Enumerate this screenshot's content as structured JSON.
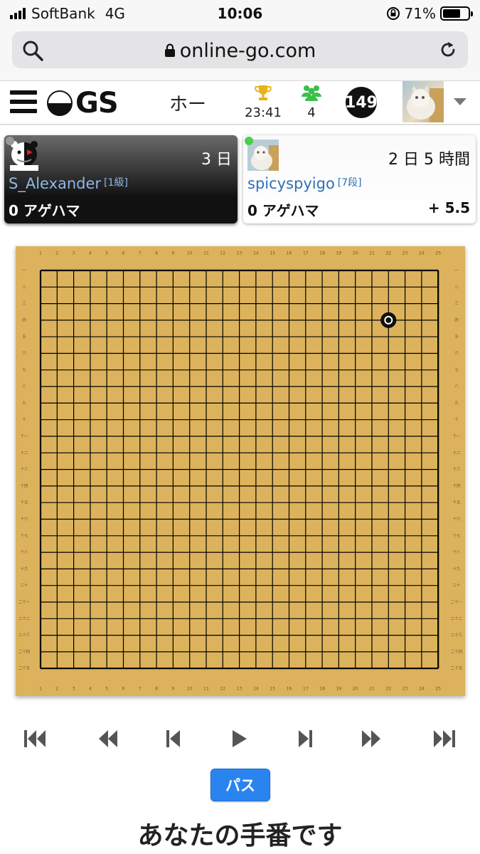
{
  "status_bar": {
    "carrier": "SoftBank",
    "network": "4G",
    "time": "10:06",
    "battery": "71%",
    "battery_level": 0.71
  },
  "browser": {
    "url": "online-go.com"
  },
  "nav": {
    "logo_text": "GS",
    "home_label": "ホー",
    "tournament_time": "23:41",
    "friends_count": "4",
    "notification_count": "149"
  },
  "players": {
    "black": {
      "name": "S_Alexander",
      "rank": "[1級]",
      "clock": "3 日",
      "captures": "0 アゲハマ",
      "online_color": "#999999"
    },
    "white": {
      "name": "spicyspyigo",
      "rank": "[7段]",
      "clock": "2 日 5 時間",
      "captures": "0 アゲハマ",
      "komi": "+ 5.5",
      "online_color": "#4ad04a"
    }
  },
  "board": {
    "size": 25,
    "board_color": "#dcb35c",
    "col_labels": [
      "1",
      "2",
      "3",
      "4",
      "5",
      "6",
      "7",
      "8",
      "9",
      "10",
      "11",
      "12",
      "13",
      "14",
      "15",
      "16",
      "17",
      "18",
      "19",
      "20",
      "21",
      "22",
      "23",
      "24",
      "25"
    ],
    "row_labels": [
      "一",
      "二",
      "三",
      "四",
      "五",
      "六",
      "七",
      "八",
      "九",
      "十",
      "十一",
      "十二",
      "十三",
      "十四",
      "十五",
      "十六",
      "十七",
      "十八",
      "十九",
      "二十",
      "二十一",
      "二十二",
      "二十三",
      "二十四",
      "二十五"
    ],
    "stones": [
      {
        "color": "black",
        "col": 22,
        "row": 4,
        "last_move": true
      }
    ]
  },
  "controls": [
    "first-move",
    "back-ten",
    "back-one",
    "play",
    "forward-one",
    "forward-ten",
    "last-move"
  ],
  "pass_label": "パス",
  "turn_message": "あなたの手番です",
  "accent_color": "#2a84f0"
}
